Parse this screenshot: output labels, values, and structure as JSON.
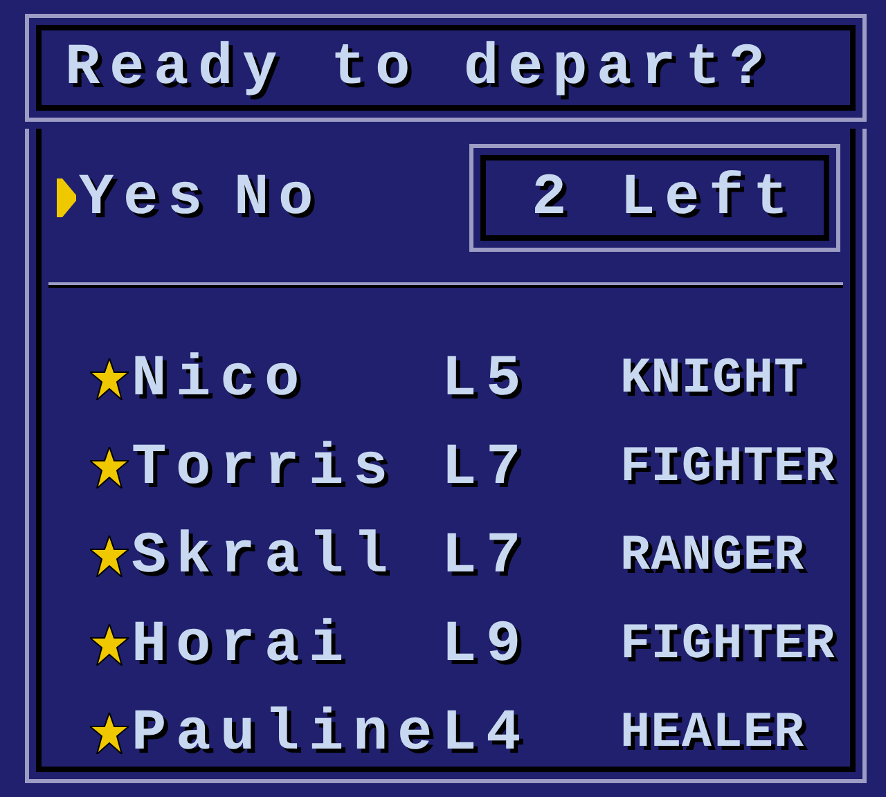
{
  "title": "Ready to depart?",
  "options": [
    {
      "label": "Yes",
      "selected": true
    },
    {
      "label": "No",
      "selected": false
    }
  ],
  "remaining": "2 Left",
  "party": [
    {
      "name": "Nico",
      "level": "L5",
      "class": "KNIGHT"
    },
    {
      "name": "Torris",
      "level": "L7",
      "class": "FIGHTER"
    },
    {
      "name": "Skrall",
      "level": "L7",
      "class": "RANGER"
    },
    {
      "name": "Horai",
      "level": "L9",
      "class": "FIGHTER"
    },
    {
      "name": "Pauline",
      "level": "L4",
      "class": "HEALER"
    }
  ]
}
